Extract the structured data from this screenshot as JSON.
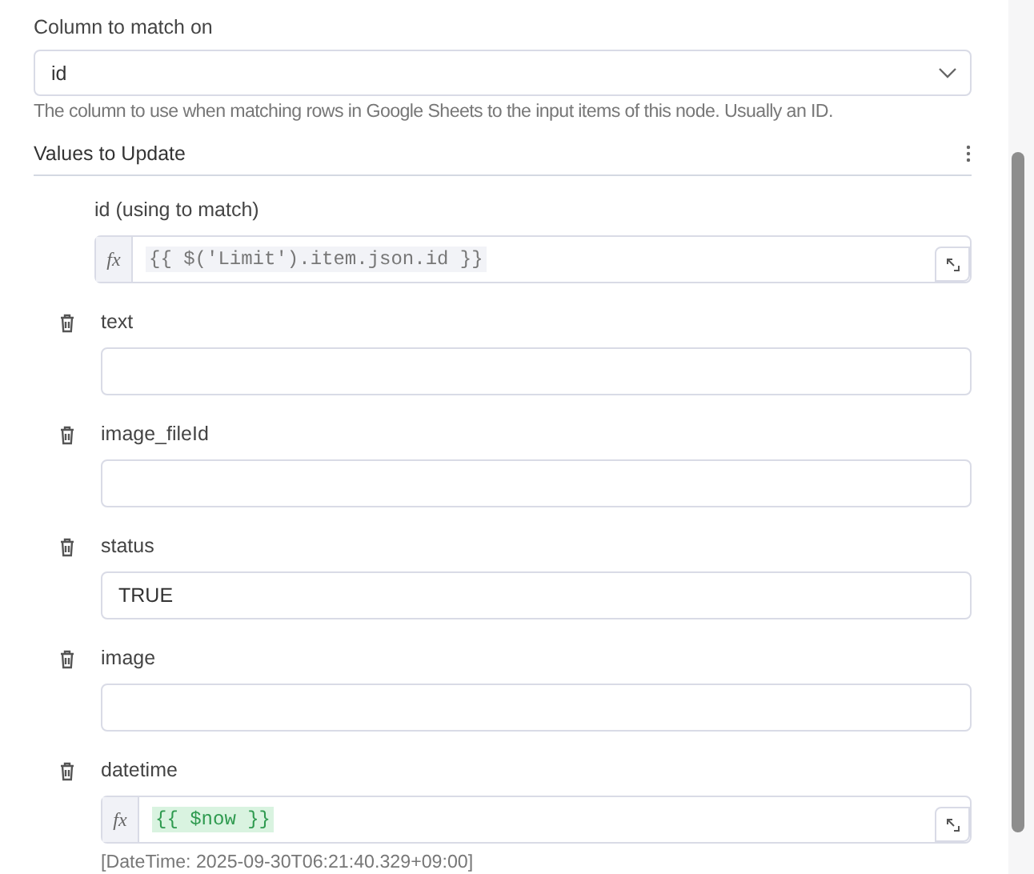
{
  "column_to_match": {
    "label": "Column to match on",
    "value": "id",
    "hint": "The column to use when matching rows in Google Sheets to the input items of this node. Usually an ID."
  },
  "values_to_update": {
    "title": "Values to Update",
    "fields": [
      {
        "label": "id (using to match)",
        "kind": "expression",
        "prefix": "fx",
        "removable": false,
        "value": "{{ $('Limit').item.json.id }}",
        "resolved": false
      },
      {
        "label": "text",
        "kind": "text",
        "removable": true
      },
      {
        "label": "image_fileId",
        "kind": "text",
        "removable": true
      },
      {
        "label": "status",
        "kind": "text",
        "removable": true,
        "value": "TRUE"
      },
      {
        "label": "image",
        "kind": "text",
        "removable": true
      },
      {
        "label": "datetime",
        "kind": "expression",
        "prefix": "fx",
        "removable": true,
        "value": "{{ $now }}",
        "resolved": true,
        "result": "[DateTime: 2025-09-30T06:21:40.329+09:00]"
      }
    ]
  }
}
